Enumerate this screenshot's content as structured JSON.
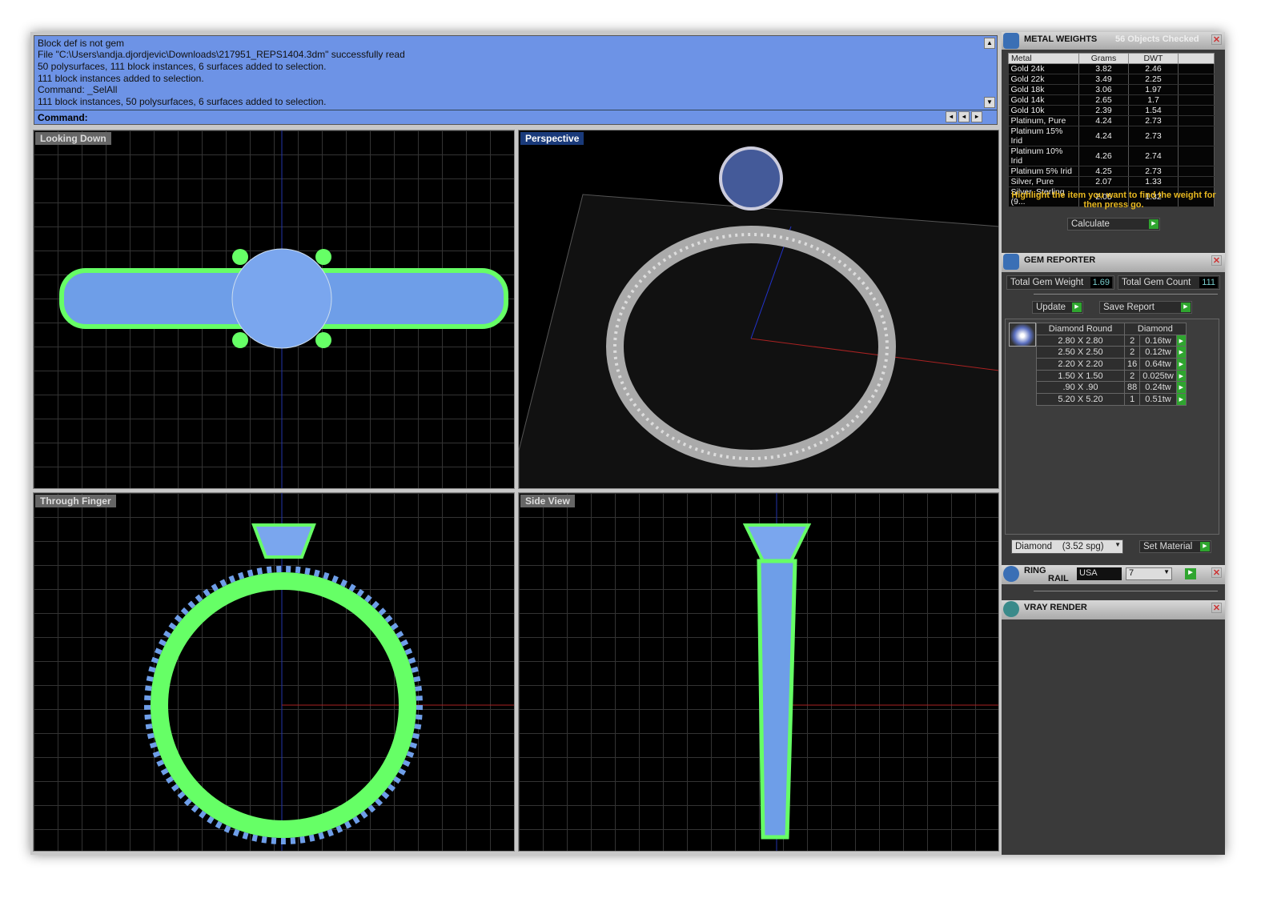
{
  "command": {
    "history": [
      "Block def is not gem",
      "File \"C:\\Users\\andja.djordjevic\\Downloads\\217951_REPS1404.3dm\" successfully read",
      "50 polysurfaces, 111 block instances, 6 surfaces added to selection.",
      "111 block instances added to selection.",
      "Command: _SelAll",
      "111 block instances, 50 polysurfaces, 6 surfaces added to selection."
    ],
    "prompt": "Command:"
  },
  "viewports": [
    {
      "label": "Looking Down"
    },
    {
      "label": "Perspective"
    },
    {
      "label": "Through Finger"
    },
    {
      "label": "Side View"
    }
  ],
  "metal_weights": {
    "title": "METAL WEIGHTS",
    "status": "56 Objects Checked",
    "headers": [
      "Metal",
      "Grams",
      "DWT"
    ],
    "rows": [
      [
        "Gold 24k",
        "3.82",
        "2.46"
      ],
      [
        "Gold 22k",
        "3.49",
        "2.25"
      ],
      [
        "Gold 18k",
        "3.06",
        "1.97"
      ],
      [
        "Gold 14k",
        "2.65",
        "1.7"
      ],
      [
        "Gold 10k",
        "2.39",
        "1.54"
      ],
      [
        "Platinum, Pure",
        "4.24",
        "2.73"
      ],
      [
        "Platinum 15% Irid",
        "4.24",
        "2.73"
      ],
      [
        "Platinum 10% Irid",
        "4.26",
        "2.74"
      ],
      [
        "Platinum 5% Irid",
        "4.25",
        "2.73"
      ],
      [
        "Silver, Pure",
        "2.07",
        "1.33"
      ],
      [
        "Silver, Sterling (9...",
        "2.05",
        "1.32"
      ]
    ],
    "hint": "Highlight the item you want to find the weight for then press go.",
    "calculate": "Calculate"
  },
  "gem_reporter": {
    "title": "GEM REPORTER",
    "total_weight_label": "Total Gem Weight",
    "total_weight": "1.69",
    "total_count_label": "Total Gem Count",
    "total_count": "111",
    "update": "Update",
    "save_report": "Save Report",
    "headers": [
      "Diamond Round",
      "Diamond"
    ],
    "rows": [
      [
        "2.80 X 2.80",
        "2",
        "0.16tw"
      ],
      [
        "2.50 X 2.50",
        "2",
        "0.12tw"
      ],
      [
        "2.20 X 2.20",
        "16",
        "0.64tw"
      ],
      [
        "1.50 X 1.50",
        "2",
        "0.025tw"
      ],
      [
        ".90 X .90",
        "88",
        "0.24tw"
      ],
      [
        "5.20 X 5.20",
        "1",
        "0.51tw"
      ]
    ],
    "material": "Diamond    (3.52 spg)",
    "set_material": "Set Material"
  },
  "ring_rail": {
    "title_1": "RING",
    "title_2": "RAIL",
    "region": "USA",
    "size": "7"
  },
  "vray": {
    "title": "VRAY RENDER"
  }
}
